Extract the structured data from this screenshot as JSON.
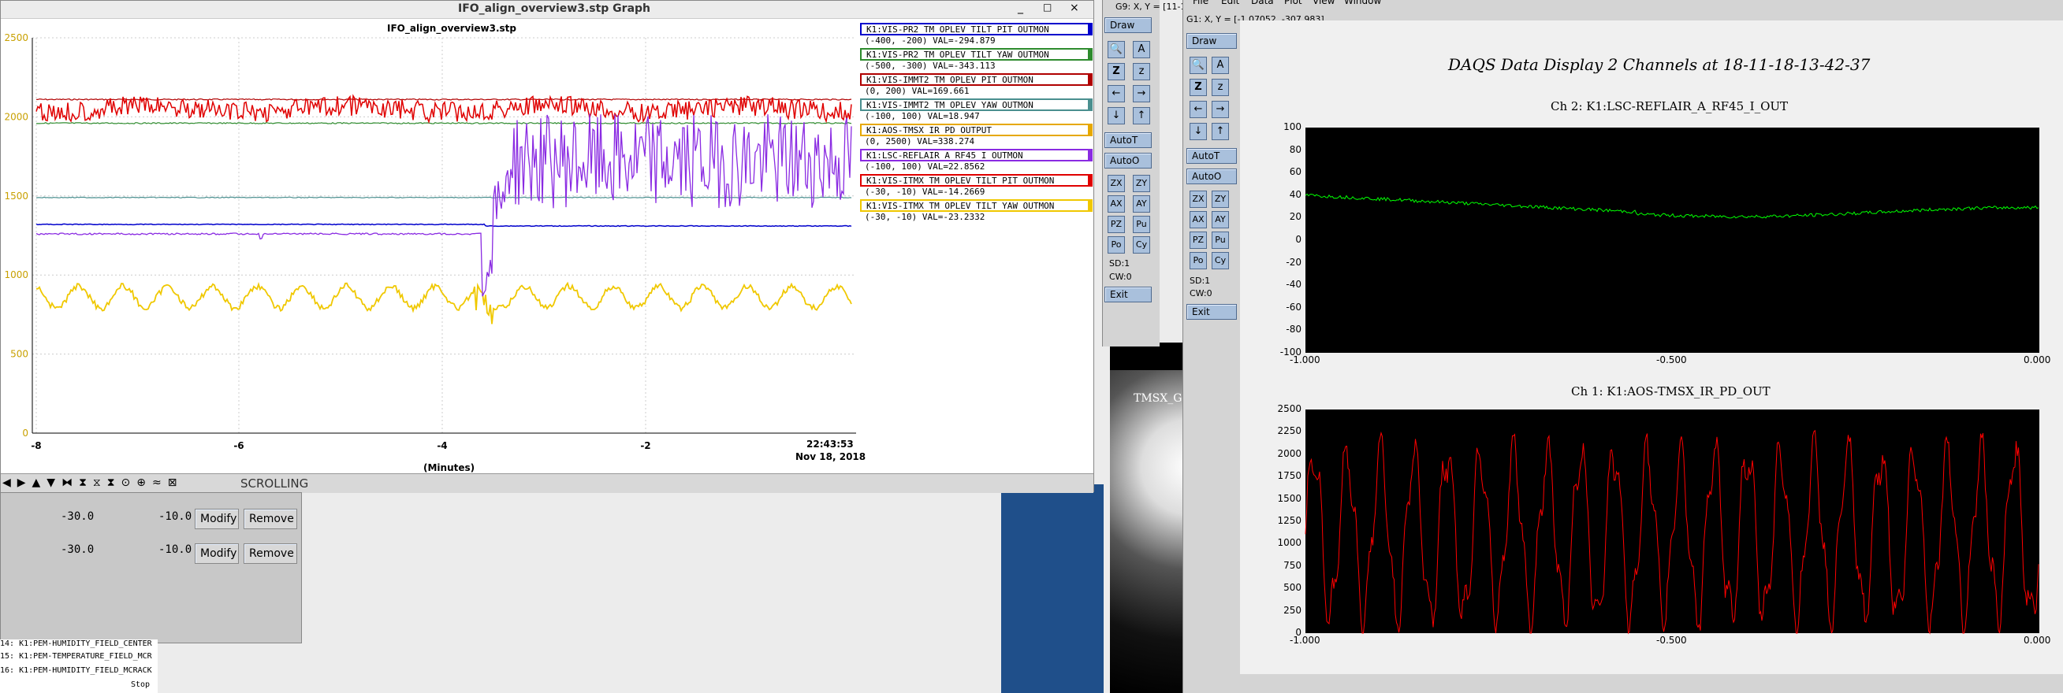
{
  "stripTool": {
    "window_title": "IFO_align_overview3.stp Graph",
    "graph_title": "IFO_align_overview3.stp",
    "yticks": [
      "2500",
      "2000",
      "1500",
      "1000",
      "500",
      "0"
    ],
    "xticks": [
      "-8",
      "-6",
      "-4",
      "-2"
    ],
    "x_time": "22:43:53",
    "x_date": "Nov 18, 2018",
    "x_axis_label": "(Minutes)",
    "scroll_status": "SCROLLING",
    "legend": [
      {
        "name": "K1:VIS-PR2_TM_OPLEV_TILT_PIT_OUTMON",
        "range": "(-400, -200) VAL=-294.879",
        "color": "#0000cc"
      },
      {
        "name": "K1:VIS-PR2_TM_OPLEV_TILT_YAW_OUTMON",
        "range": "(-500, -300) VAL=-343.113",
        "color": "#2e8b2e"
      },
      {
        "name": "K1:VIS-IMMT2_TM_OPLEV_PIT_OUTMON",
        "range": "(0, 200) VAL=169.661",
        "color": "#b00000"
      },
      {
        "name": "K1:VIS-IMMT2_TM_OPLEV_YAW_OUTMON",
        "range": "(-100, 100) VAL=18.947",
        "color": "#4a8f8f"
      },
      {
        "name": "K1:AOS-TMSX_IR_PD_OUTPUT",
        "range": "(0, 2500) VAL=338.274",
        "color": "#e6a800"
      },
      {
        "name": "K1:LSC-REFLAIR_A_RF45_I_OUTMON",
        "range": "(-100, 100) VAL=22.8562",
        "color": "#8a2be2"
      },
      {
        "name": "K1:VIS-ITMX_TM_OPLEV_TILT_PIT_OUTMON",
        "range": "(-30, -10) VAL=-14.2669",
        "color": "#e00000"
      },
      {
        "name": "K1:VIS-ITMX_TM_OPLEV_TILT_YAW_OUTMON",
        "range": "(-30, -10) VAL=-23.2332",
        "color": "#f0c800"
      }
    ]
  },
  "configPanel": {
    "rows": [
      {
        "min": "-30.0",
        "max": "-10.0",
        "modify": "Modify",
        "remove": "Remove"
      },
      {
        "min": "-30.0",
        "max": "-10.0",
        "modify": "Modify",
        "remove": "Remove"
      }
    ],
    "list_items": [
      "14: K1:PEM-HUMIDITY_FIELD_CENTER",
      "15: K1:PEM-TEMPERATURE_FIELD_MCR",
      "16: K1:PEM-HUMIDITY_FIELD_MCRACK"
    ],
    "stop_label": "Stop"
  },
  "g9": {
    "title": "G9: X, Y = [11-1",
    "buttons": {
      "draw": "Draw",
      "autot": "AutoT",
      "autoo": "AutoO",
      "sd": "SD:1",
      "cw": "CW:0",
      "exit": "Exit"
    },
    "pairs": [
      [
        "ZX",
        "ZY"
      ],
      [
        "AX",
        "AY"
      ],
      [
        "PZ",
        "Pu"
      ],
      [
        "Po",
        "Cy"
      ]
    ]
  },
  "g1": {
    "title": "G1: X, Y = [-1.07052, -307.983]",
    "menu": [
      "File",
      "Edit",
      "Data",
      "Plot",
      "View",
      "Window"
    ],
    "buttons": {
      "draw": "Draw",
      "autot": "AutoT",
      "autoo": "AutoO",
      "sd": "SD:1",
      "cw": "CW:0",
      "exit": "Exit"
    },
    "pairs": [
      [
        "ZX",
        "ZY"
      ],
      [
        "AX",
        "AY"
      ],
      [
        "PZ",
        "Pu"
      ],
      [
        "Po",
        "Cy"
      ]
    ]
  },
  "camera": {
    "label": "TMSX_G"
  },
  "daqs": {
    "title": "DAQS Data Display 2 Channels at 18-11-18-13-42-37",
    "ch2": {
      "title": "Ch 2:  K1:LSC-REFLAIR_A_RF45_I_OUT",
      "yticks": [
        "100",
        "80",
        "60",
        "40",
        "20",
        "0",
        "-20",
        "-40",
        "-60",
        "-80",
        "-100"
      ],
      "xticks": [
        "-1.000",
        "-0.500",
        "0.000"
      ],
      "color": "#00ff00"
    },
    "ch1": {
      "title": "Ch 1:  K1:AOS-TMSX_IR_PD_OUT",
      "yticks": [
        "2500",
        "2250",
        "2000",
        "1750",
        "1500",
        "1250",
        "1000",
        "750",
        "500",
        "250",
        "0"
      ],
      "xticks": [
        "-1.000",
        "-0.500",
        "0.000"
      ],
      "color": "#ff0000"
    }
  },
  "chart_data": [
    {
      "type": "line",
      "title": "IFO_align_overview3.stp",
      "xlabel": "(Minutes)",
      "ylim": [
        0,
        2500
      ],
      "xlim": [
        -8,
        0
      ],
      "series": [
        {
          "name": "K1:VIS-ITMX_TM_OPLEV_TILT_PIT_OUTMON",
          "level": 2050,
          "noise": 40
        },
        {
          "name": "K1:VIS-PR2_TM_OPLEV_TILT_YAW_OUTMON",
          "level": 1960,
          "noise": 3
        },
        {
          "name": "K1:VIS-IMMT2_TM_OPLEV_YAW_OUTMON",
          "level": 1490,
          "noise": 2
        },
        {
          "name": "K1:VIS-PR2_TM_OPLEV_TILT_PIT_OUTMON",
          "level": 1320,
          "noise": 2
        },
        {
          "name": "K1:LSC-REFLAIR_A_RF45_I_OUTMON",
          "level": 1260,
          "noise": 3
        },
        {
          "name": "K1:VIS-ITMX_TM_OPLEV_TILT_YAW_OUTMON",
          "level": 860,
          "noise": 60
        },
        {
          "name": "K1:VIS-IMMT2_TM_OPLEV_PIT_OUTMON",
          "level": 2110,
          "noise": 2
        }
      ]
    },
    {
      "type": "line",
      "title": "Ch 2:  K1:LSC-REFLAIR_A_RF45_I_OUT",
      "ylim": [
        -100,
        100
      ],
      "xlim": [
        -1,
        0
      ],
      "series": [
        {
          "start": 40,
          "end": 25
        }
      ]
    },
    {
      "type": "line",
      "title": "Ch 1:  K1:AOS-TMSX_IR_PD_OUT",
      "ylim": [
        0,
        2500
      ],
      "xlim": [
        -1,
        0
      ],
      "series": [
        {
          "min": 0,
          "max": 2300
        }
      ]
    }
  ]
}
